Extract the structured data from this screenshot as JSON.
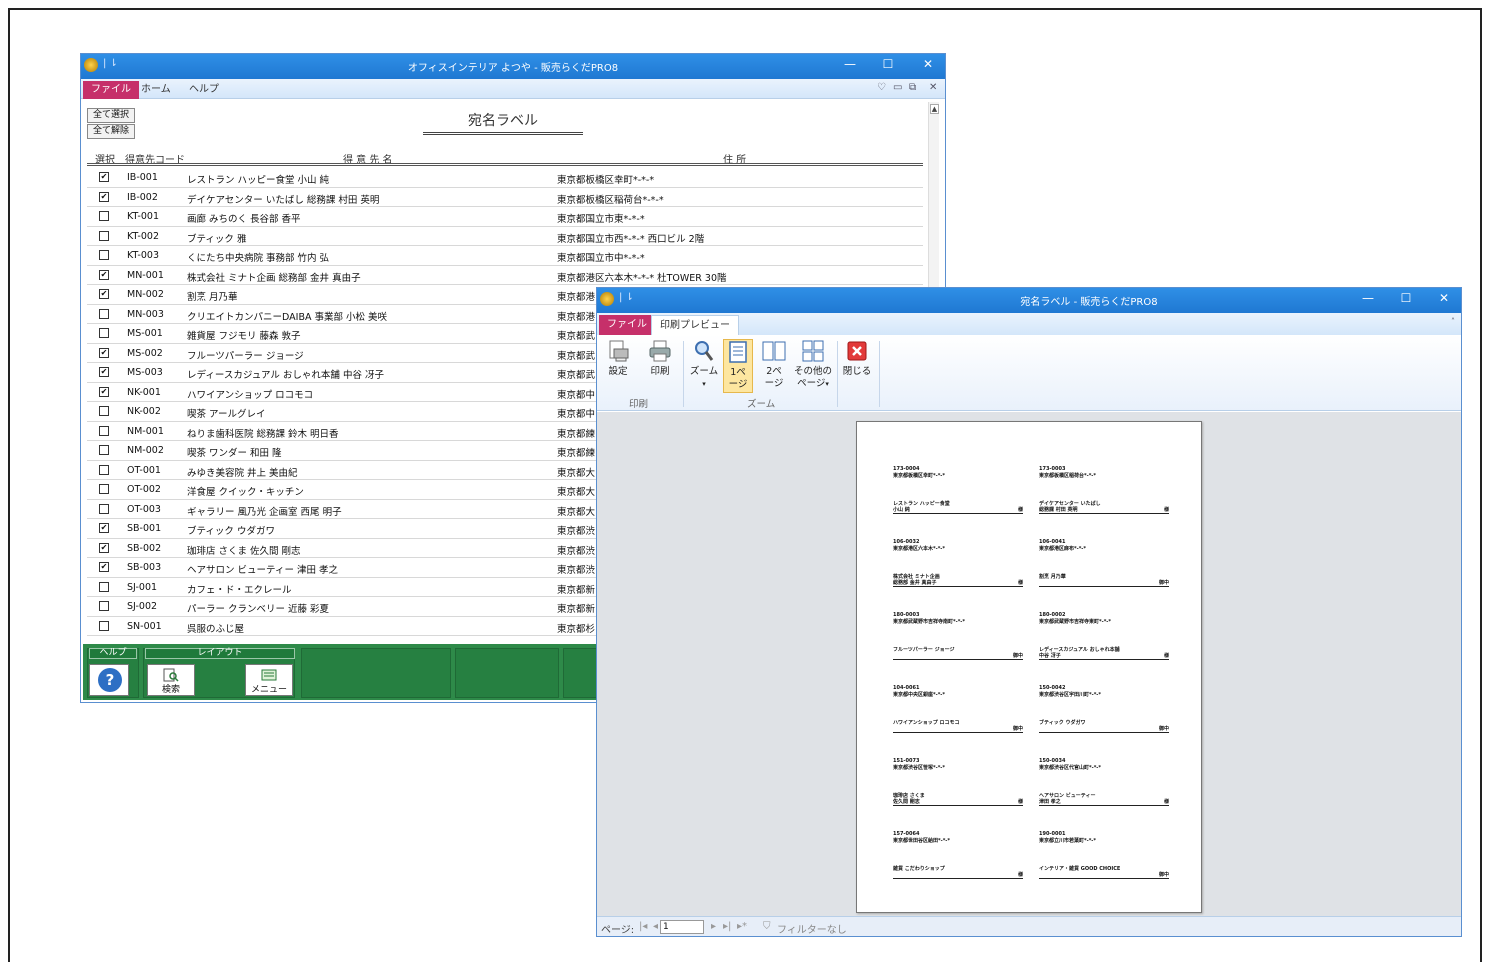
{
  "window1": {
    "title": "オフィスインテリア よつや - 販売らくだPRO8",
    "tabs": [
      "ファイル",
      "ホーム",
      "ヘルプ"
    ],
    "select_all": "全て選択",
    "deselect_all": "全て解除",
    "form_title": "宛名ラベル",
    "columns": {
      "select": "選択",
      "code": "得意先コード",
      "name": "得 意 先 名",
      "address": "住 所"
    },
    "rows": [
      {
        "checked": true,
        "code": "IB-001",
        "name": "レストラン ハッピー食堂 小山 純",
        "address": "東京都板橋区幸町*-*-*"
      },
      {
        "checked": true,
        "code": "IB-002",
        "name": "デイケアセンター いたばし 総務課 村田 英明",
        "address": "東京都板橋区稲荷台*-*-*"
      },
      {
        "checked": false,
        "code": "KT-001",
        "name": "画廊 みちのく 長谷部 香平",
        "address": "東京都国立市東*-*-*"
      },
      {
        "checked": false,
        "code": "KT-002",
        "name": "ブティック 雅",
        "address": "東京都国立市西*-*-* 西口ビル 2階"
      },
      {
        "checked": false,
        "code": "KT-003",
        "name": "くにたち中央病院 事務部 竹内 弘",
        "address": "東京都国立市中*-*-*"
      },
      {
        "checked": true,
        "code": "MN-001",
        "name": "株式会社 ミナト企画 総務部 金井 真由子",
        "address": "東京都港区六本木*-*-* 杜TOWER 30階"
      },
      {
        "checked": true,
        "code": "MN-002",
        "name": "割烹 月乃華",
        "address": "東京都港"
      },
      {
        "checked": false,
        "code": "MN-003",
        "name": "クリエイトカンパニーDAIBA 事業部 小松 美咲",
        "address": "東京都港"
      },
      {
        "checked": false,
        "code": "MS-001",
        "name": "雑貨屋 フジモリ 藤森 敦子",
        "address": "東京都武"
      },
      {
        "checked": true,
        "code": "MS-002",
        "name": "フルーツパーラー ジョージ",
        "address": "東京都武"
      },
      {
        "checked": true,
        "code": "MS-003",
        "name": "レディースカジュアル おしゃれ本舗 中谷 冴子",
        "address": "東京都武"
      },
      {
        "checked": true,
        "code": "NK-001",
        "name": "ハワイアンショップ ロコモコ",
        "address": "東京都中"
      },
      {
        "checked": false,
        "code": "NK-002",
        "name": "喫茶 アールグレイ",
        "address": "東京都中"
      },
      {
        "checked": false,
        "code": "NM-001",
        "name": "ねりま歯科医院 総務課 鈴木 明日香",
        "address": "東京都練"
      },
      {
        "checked": false,
        "code": "NM-002",
        "name": "喫茶 ワンダー 和田 隆",
        "address": "東京都練"
      },
      {
        "checked": false,
        "code": "OT-001",
        "name": "みゆき美容院 井上 美由紀",
        "address": "東京都大"
      },
      {
        "checked": false,
        "code": "OT-002",
        "name": "洋食屋 クイック・キッチン",
        "address": "東京都大"
      },
      {
        "checked": false,
        "code": "OT-003",
        "name": "ギャラリー 風乃光 企画室 西尾 明子",
        "address": "東京都大"
      },
      {
        "checked": true,
        "code": "SB-001",
        "name": "ブティック ウダガワ",
        "address": "東京都渋"
      },
      {
        "checked": true,
        "code": "SB-002",
        "name": "珈琲店 さくま 佐久間 剛志",
        "address": "東京都渋"
      },
      {
        "checked": true,
        "code": "SB-003",
        "name": "ヘアサロン ビューティー 津田 孝之",
        "address": "東京都渋"
      },
      {
        "checked": false,
        "code": "SJ-001",
        "name": "カフェ・ド・エクレール",
        "address": "東京都新"
      },
      {
        "checked": false,
        "code": "SJ-002",
        "name": "パーラー クランベリー 近藤 彩夏",
        "address": "東京都新"
      },
      {
        "checked": false,
        "code": "SN-001",
        "name": "呉服のふじ屋",
        "address": "東京都杉"
      }
    ],
    "bottom": {
      "help_label": "ヘルプ",
      "layout_label": "レイアウト",
      "search_label": "検索",
      "menu_label": "メニュー"
    }
  },
  "window2": {
    "title": "宛名ラベル - 販売らくだPRO8",
    "tabs": {
      "file": "ファイル",
      "preview": "印刷プレビュー"
    },
    "buttons": {
      "setup": "設定",
      "print": "印刷",
      "zoom": "ズーム",
      "one_page_1": "1ペ",
      "one_page_2": "ージ",
      "two_page_1": "2ペ",
      "two_page_2": "ージ",
      "other_1": "その他の",
      "other_2": "ページ",
      "close": "閉じる"
    },
    "groups": {
      "print": "印刷",
      "zoom": "ズーム"
    },
    "status": {
      "page_label": "ページ:",
      "page_value": "1",
      "filter": "フィルターなし"
    },
    "labels": [
      {
        "zip": "173-0004",
        "addr": "東京都板橋区幸町*-*-*",
        "name": "レストラン ハッピー食堂",
        "name2": "小山 純",
        "honor": "様"
      },
      {
        "zip": "173-0003",
        "addr": "東京都板橋区稲荷台*-*-*",
        "name": "デイケアセンター いたばし",
        "name2": "総務課 村田 英明",
        "honor": "様"
      },
      {
        "zip": "106-0032",
        "addr": "東京都港区六本木*-*-*",
        "name": "株式会社 ミナト企画",
        "name2": "総務部 金井 真由子",
        "honor": "様"
      },
      {
        "zip": "106-0041",
        "addr": "東京都港区麻布*-*-*",
        "name": "割烹 月乃華",
        "name2": "",
        "honor": "御中"
      },
      {
        "zip": "180-0003",
        "addr": "東京都武蔵野市吉祥寺南町*-*-*",
        "name": "フルーツパーラー ジョージ",
        "name2": "",
        "honor": "御中"
      },
      {
        "zip": "180-0002",
        "addr": "東京都武蔵野市吉祥寺東町*-*-*",
        "name": "レディースカジュアル おしゃれ本舗",
        "name2": "中谷 冴子",
        "honor": "様"
      },
      {
        "zip": "104-0061",
        "addr": "東京都中央区銀座*-*-*",
        "name": "ハワイアンショップ ロコモコ",
        "name2": "",
        "honor": "御中"
      },
      {
        "zip": "150-0042",
        "addr": "東京都渋谷区宇田川町*-*-*",
        "name": "ブティック ウダガワ",
        "name2": "",
        "honor": "御中"
      },
      {
        "zip": "151-0073",
        "addr": "東京都渋谷区笹塚*-*-*",
        "name": "珈琲店 さくま",
        "name2": "佐久間 剛志",
        "honor": "様"
      },
      {
        "zip": "150-0034",
        "addr": "東京都渋谷区代官山町*-*-*",
        "name": "ヘアサロン ビューティー",
        "name2": "津田 孝之",
        "honor": "様"
      },
      {
        "zip": "157-0064",
        "addr": "東京都世田谷区給田*-*-*",
        "name": "雑貨 こだわりショップ",
        "name2": "",
        "honor": "様"
      },
      {
        "zip": "190-0001",
        "addr": "東京都立川市若葉町*-*-*",
        "name": "インテリア・雑貨 GOOD CHOICE",
        "name2": "",
        "honor": "御中"
      }
    ]
  }
}
